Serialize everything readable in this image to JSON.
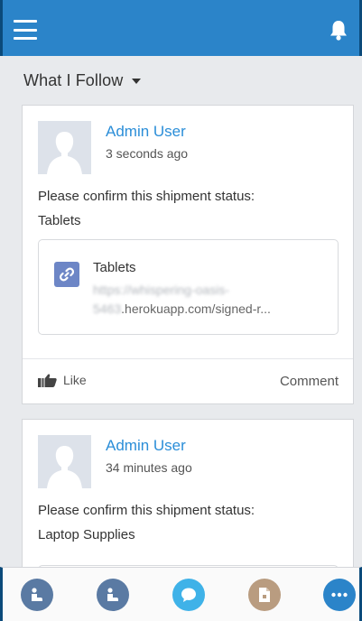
{
  "header": {
    "menu_icon": "hamburger-icon",
    "notifications_icon": "bell-icon",
    "background_color": "#2b84c9"
  },
  "feed_filter": {
    "label": "What I Follow",
    "caret_icon": "caret-down-icon"
  },
  "posts": [
    {
      "author": "Admin User",
      "time": "3 seconds ago",
      "body_line1": "Please confirm this shipment status:",
      "body_line2": "Tablets",
      "link": {
        "icon": "link-icon",
        "title": "Tablets",
        "url_blurred_1": "https://whispering-oasis-",
        "url_blurred_2": "5463",
        "url_visible": ".herokuapp.com/signed-r..."
      },
      "like_label": "Like",
      "comment_label": "Comment"
    },
    {
      "author": "Admin User",
      "time": "34 minutes ago",
      "body_line1": "Please confirm this shipment status:",
      "body_line2": "Laptop Supplies"
    }
  ],
  "tabbar": {
    "tabs": [
      {
        "name": "approvals-tab",
        "icon": "app-icon",
        "color": "#5a7aa3"
      },
      {
        "name": "actions-tab",
        "icon": "app-icon",
        "color": "#5a7aa3"
      },
      {
        "name": "chatter-tab",
        "icon": "speech-bubble-icon",
        "color": "#3fb2e8"
      },
      {
        "name": "files-tab",
        "icon": "file-icon",
        "color": "#b99c80"
      },
      {
        "name": "more-tab",
        "icon": "ellipsis-icon",
        "color": "#2b84c9"
      }
    ]
  }
}
